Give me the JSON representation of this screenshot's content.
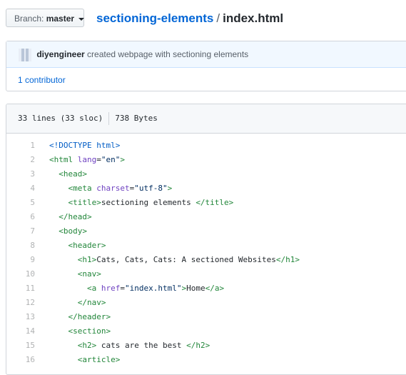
{
  "header": {
    "branch_prefix": "Branch:",
    "branch_name": "master",
    "repo": "sectioning-elements",
    "separator": "/",
    "file": "index.html"
  },
  "commit": {
    "author": "diyengineer",
    "message": "created webpage with sectioning elements",
    "contributors": "1 contributor"
  },
  "file_info": {
    "lines": "33 lines (33 sloc)",
    "size": "738 Bytes"
  },
  "code": [
    {
      "num": "1",
      "segments": [
        {
          "t": "<!DOCTYPE html>",
          "c": "doctype"
        }
      ]
    },
    {
      "num": "2",
      "segments": [
        {
          "t": "<",
          "c": "tag"
        },
        {
          "t": "html",
          "c": "tag"
        },
        {
          "t": " "
        },
        {
          "t": "lang",
          "c": "attr"
        },
        {
          "t": "="
        },
        {
          "t": "\"en\"",
          "c": "str"
        },
        {
          "t": ">",
          "c": "tag"
        }
      ]
    },
    {
      "num": "3",
      "segments": [
        {
          "t": "  "
        },
        {
          "t": "<head>",
          "c": "tag"
        }
      ]
    },
    {
      "num": "4",
      "segments": [
        {
          "t": "    "
        },
        {
          "t": "<meta",
          "c": "tag"
        },
        {
          "t": " "
        },
        {
          "t": "charset",
          "c": "attr"
        },
        {
          "t": "="
        },
        {
          "t": "\"utf-8\"",
          "c": "str"
        },
        {
          "t": ">",
          "c": "tag"
        }
      ]
    },
    {
      "num": "5",
      "segments": [
        {
          "t": "    "
        },
        {
          "t": "<title>",
          "c": "tag"
        },
        {
          "t": "sectioning elements "
        },
        {
          "t": "</title>",
          "c": "tag"
        }
      ]
    },
    {
      "num": "6",
      "segments": [
        {
          "t": "  "
        },
        {
          "t": "</head>",
          "c": "tag"
        }
      ]
    },
    {
      "num": "7",
      "segments": [
        {
          "t": "  "
        },
        {
          "t": "<body>",
          "c": "tag"
        }
      ]
    },
    {
      "num": "8",
      "segments": [
        {
          "t": "    "
        },
        {
          "t": "<header>",
          "c": "tag"
        }
      ]
    },
    {
      "num": "9",
      "segments": [
        {
          "t": "      "
        },
        {
          "t": "<h1>",
          "c": "tag"
        },
        {
          "t": "Cats, Cats, Cats: A sectioned Websites"
        },
        {
          "t": "</h1>",
          "c": "tag"
        }
      ]
    },
    {
      "num": "10",
      "segments": [
        {
          "t": "      "
        },
        {
          "t": "<nav>",
          "c": "tag"
        }
      ]
    },
    {
      "num": "11",
      "segments": [
        {
          "t": "        "
        },
        {
          "t": "<a",
          "c": "tag"
        },
        {
          "t": " "
        },
        {
          "t": "href",
          "c": "attr"
        },
        {
          "t": "="
        },
        {
          "t": "\"index.html\"",
          "c": "str"
        },
        {
          "t": ">",
          "c": "tag"
        },
        {
          "t": "Home"
        },
        {
          "t": "</a>",
          "c": "tag"
        }
      ]
    },
    {
      "num": "12",
      "segments": [
        {
          "t": "      "
        },
        {
          "t": "</nav>",
          "c": "tag"
        }
      ]
    },
    {
      "num": "13",
      "segments": [
        {
          "t": "    "
        },
        {
          "t": "</header>",
          "c": "tag"
        }
      ]
    },
    {
      "num": "14",
      "segments": [
        {
          "t": "    "
        },
        {
          "t": "<section>",
          "c": "tag"
        }
      ]
    },
    {
      "num": "15",
      "segments": [
        {
          "t": "      "
        },
        {
          "t": "<h2>",
          "c": "tag"
        },
        {
          "t": " cats are the best "
        },
        {
          "t": "</h2>",
          "c": "tag"
        }
      ]
    },
    {
      "num": "16",
      "segments": [
        {
          "t": "      "
        },
        {
          "t": "<article>",
          "c": "tag"
        }
      ]
    }
  ],
  "colors": {
    "link": "#0366d6",
    "tag": "#22863a",
    "attr": "#6f42c1",
    "string": "#032f62",
    "commit_bg": "#f1f8ff"
  }
}
